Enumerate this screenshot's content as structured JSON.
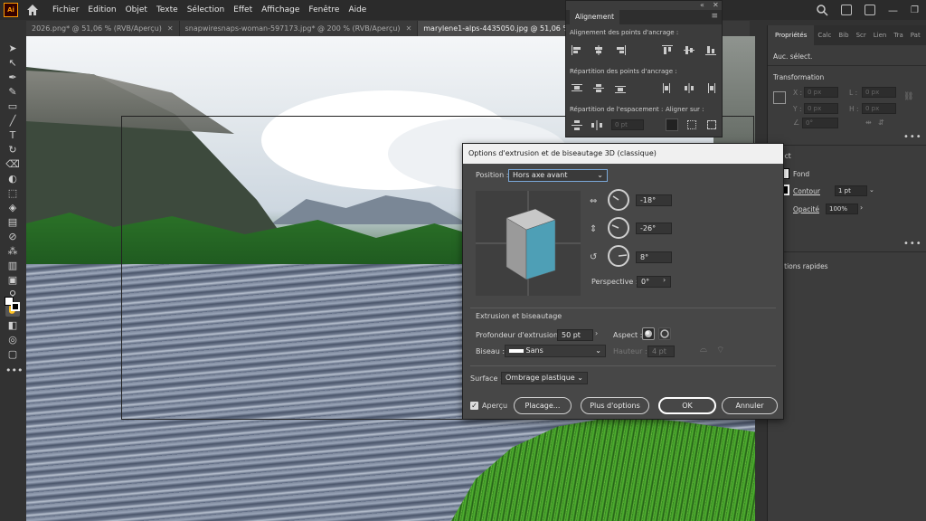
{
  "app": {
    "logo": "Ai"
  },
  "menu": [
    "Fichier",
    "Edition",
    "Objet",
    "Texte",
    "Sélection",
    "Effet",
    "Affichage",
    "Fenêtre",
    "Aide"
  ],
  "tabs": [
    {
      "label": "2026.png* @ 51,06 % (RVB/Aperçu)",
      "active": false
    },
    {
      "label": "snapwiresnaps-woman-597173.jpg* @ 200 % (RVB/Aperçu)",
      "active": false
    },
    {
      "label": "marylene1-alps-4435050.jpg @ 51,06 % (RVB/Aperç",
      "active": true
    }
  ],
  "align_panel": {
    "tab": "Alignement",
    "sec1": "Alignement des points d'ancrage :",
    "sec2": "Répartition des points d'ancrage :",
    "sec3": "Répartition de l'espacement :",
    "sec4": "Aligner sur :",
    "spacing_value": "0 pt"
  },
  "properties": {
    "tabs": [
      "Propriétés",
      "Calc",
      "Bib",
      "Scr",
      "Lien",
      "Tra",
      "Pat"
    ],
    "no_selection": "Auc. sélect.",
    "transform": "Transformation",
    "x_label": "X :",
    "y_label": "Y :",
    "l_label": "L :",
    "h_label": "H :",
    "x_value": "0 px",
    "y_value": "0 px",
    "l_value": "0 px",
    "h_value": "0 px",
    "angle_value": "0°",
    "aspect": "ect",
    "fond": "Fond",
    "contour": "Contour",
    "contour_value": "1 pt",
    "opacite": "Opacité",
    "opacite_value": "100%",
    "actions": "ctions rapides"
  },
  "dialog": {
    "title": "Options d'extrusion et de biseautage 3D (classique)",
    "position_label": "Position :",
    "position_value": "Hors axe avant",
    "rot_x": "-18°",
    "rot_y": "-26°",
    "rot_z": "8°",
    "perspective_label": "Perspective :",
    "perspective_value": "0°",
    "section": "Extrusion et biseautage",
    "depth_label": "Profondeur d'extrusion :",
    "depth_value": "50 pt",
    "cap_label": "Aspect :",
    "bevel_label": "Biseau :",
    "bevel_value": "Sans",
    "height_label": "Hauteur :",
    "height_value": "4 pt",
    "surface_label": "Surface :",
    "surface_value": "Ombrage plastique",
    "preview_label": "Aperçu",
    "map_btn": "Placage...",
    "more_btn": "Plus d'options",
    "ok_btn": "OK",
    "cancel_btn": "Annuler",
    "cube_face_color": "#4e9fb6"
  }
}
